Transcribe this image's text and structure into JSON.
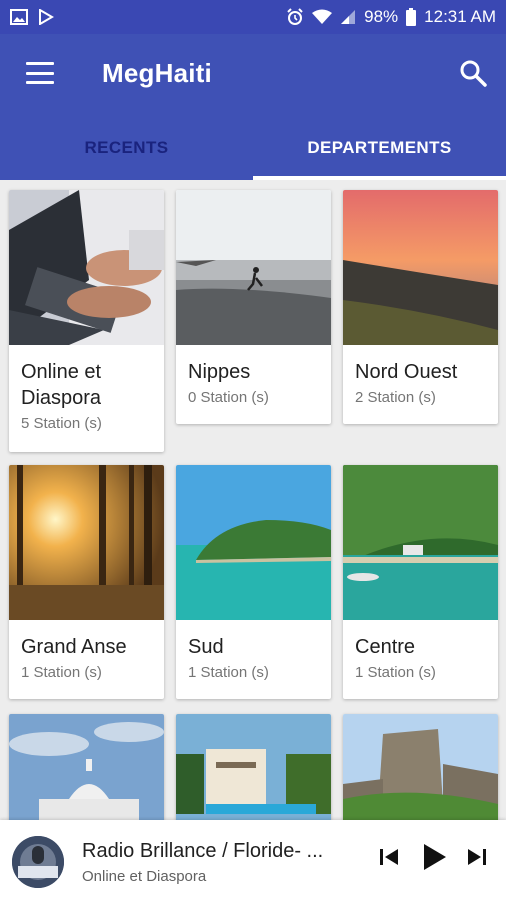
{
  "status": {
    "battery": "98%",
    "time": "12:31 AM"
  },
  "app": {
    "title": "MegHaiti"
  },
  "tabs": [
    {
      "label": "RECENTS"
    },
    {
      "label": "DEPARTEMENTS"
    }
  ],
  "departments": [
    {
      "name": "Online et Diaspora",
      "count": "5 Station (s)"
    },
    {
      "name": "Nippes",
      "count": "0 Station (s)"
    },
    {
      "name": "Nord Ouest",
      "count": "2 Station (s)"
    },
    {
      "name": "Grand Anse",
      "count": "1 Station (s)"
    },
    {
      "name": "Sud",
      "count": "1 Station (s)"
    },
    {
      "name": "Centre",
      "count": "1 Station (s)"
    }
  ],
  "player": {
    "title": "Radio Brillance / Floride- ...",
    "subtitle": "Online et Diaspora"
  },
  "colors": {
    "primary": "#3f51b5",
    "statusbar": "#3a48b3",
    "tab_inactive": "#1a237e"
  }
}
